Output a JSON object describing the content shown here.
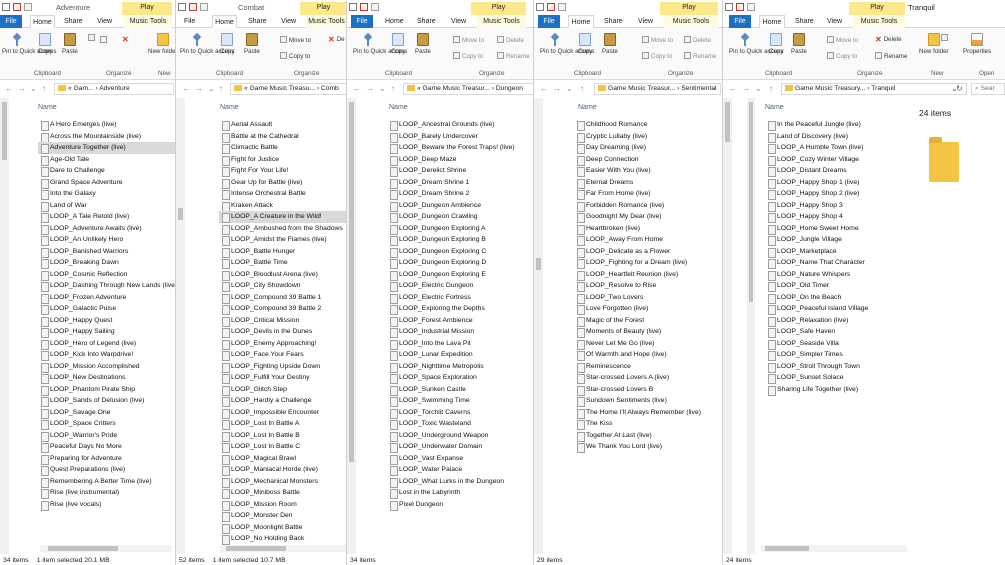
{
  "ribbon_tabs": {
    "file": "File",
    "home": "Home",
    "share": "Share",
    "view": "View",
    "music_tools": "Music Tools",
    "play": "Play"
  },
  "ribbon_labels": {
    "pin": "Pin to Quick access",
    "copy": "Copy",
    "paste": "Paste",
    "new_folder": "New folder",
    "properties": "Properties",
    "clipboard": "Clipboard",
    "organize": "Organize",
    "new": "New",
    "open": "Open",
    "move_to": "Move to",
    "copy_to": "Copy to",
    "delete": "Delete",
    "rename": "Rename",
    "delete_short": "De"
  },
  "column_name": "Name",
  "windows": [
    {
      "title": "Adventure",
      "path": "« Gam... › Adventure",
      "status_items": "34 items",
      "status_sel": "1 item selected  20.1 MB",
      "files": [
        "A Hero Emerges (live)",
        "Across the Mountainside (live)",
        "Adventure Together (live)",
        "Age-Old Tale",
        "Dare to Challenge",
        "Grand Space Adventure",
        "Into the Galaxy",
        "Land of War",
        "LOOP_A Tale Retold (live)",
        "LOOP_Adventure Awaits (live)",
        "LOOP_An Unlikely Hero",
        "LOOP_Banished Warriors",
        "LOOP_Breaking Dawn",
        "LOOP_Cosmic Reflection",
        "LOOP_Dashing Through New Lands (live)",
        "LOOP_Frozen Adventure",
        "LOOP_Galactic Pulse",
        "LOOP_Happy Quest",
        "LOOP_Happy Sailing",
        "LOOP_Hero of Legend (live)",
        "LOOP_Kick Into Warpdrive!",
        "LOOP_Mission Accomplished",
        "LOOP_New Destinations",
        "LOOP_Phantom Pirate Ship",
        "LOOP_Sands of Delusion (live)",
        "LOOP_Savage One",
        "LOOP_Space Critters",
        "LOOP_Warrior's Pride",
        "Peaceful Days No More",
        "Preparing for Adventure",
        "Quest Preparations (live)",
        "Remembering A Better Time (live)",
        "Rise (live instrumental)",
        "Rise (live vocals)"
      ],
      "selected": 2
    },
    {
      "title": "Combat",
      "path": "« Game Music Treasu... › Comb",
      "status_items": "52 items",
      "status_sel": "1 item selected  10.7 MB",
      "files": [
        "Aerial Assault",
        "Battle at the Cathedral",
        "Climactic Battle",
        "Fight for Justice",
        "Fight For Your Life!",
        "Gear Up for Battle (live)",
        "Intense Orchestral Battle",
        "Kraken Attack",
        "LOOP_A Creature in the Wild!",
        "LOOP_Ambushed from the Shadows",
        "LOOP_Amidst the Flames (live)",
        "LOOP_Battle Hunger",
        "LOOP_Battle Time",
        "LOOP_Bloodlust Arena (live)",
        "LOOP_City Showdown",
        "LOOP_Compound 39 Battle 1",
        "LOOP_Compound 39 Battle 2",
        "LOOP_Critical Mission",
        "LOOP_Devils in the Dunes",
        "LOOP_Enemy Approaching!",
        "LOOP_Face Your Fears",
        "LOOP_Fighting Upside Down",
        "LOOP_Fulfill Your Destiny",
        "LOOP_Glitch Step",
        "LOOP_Hardly a Challenge",
        "LOOP_Impossible Encounter",
        "LOOP_Lost In Battle A",
        "LOOP_Lost In Battle B",
        "LOOP_Lost In Battle C",
        "LOOP_Magical Brawl",
        "LOOP_Maniacal Horde (live)",
        "LOOP_Mechanical Monsters",
        "LOOP_Miniboss Battle",
        "LOOP_Mission Room",
        "LOOP_Monster Den",
        "LOOP_Moonlight Battle",
        "LOOP_No Holding Back"
      ],
      "selected": 8
    },
    {
      "title": "",
      "path": "« Game Music Treasur... › Dungeon",
      "status_items": "34 items",
      "status_sel": "",
      "files": [
        "LOOP_Ancestral Grounds (live)",
        "LOOP_Barely Undercover",
        "LOOP_Beware the Forest Traps! (live)",
        "LOOP_Deep Maze",
        "LOOP_Derelict Shrine",
        "LOOP_Dream Shrine 1",
        "LOOP_Dream Shrine 2",
        "LOOP_Dungeon Ambience",
        "LOOP_Dungeon Crawling",
        "LOOP_Dungeon Exploring A",
        "LOOP_Dungeon Exploring B",
        "LOOP_Dungeon Exploring C",
        "LOOP_Dungeon Exploring D",
        "LOOP_Dungeon Exploring E",
        "LOOP_Electric Dungeon",
        "LOOP_Electric Fortress",
        "LOOP_Exploring the Depths",
        "LOOP_Forest Ambience",
        "LOOP_Industrial Mission",
        "LOOP_Into the Lava Pit",
        "LOOP_Lunar Expedition",
        "LOOP_Nighttime Metropolis",
        "LOOP_Space Exploration",
        "LOOP_Sunken Castle",
        "LOOP_Swimming Time",
        "LOOP_Torchlit Caverns",
        "LOOP_Toxic Wasteland",
        "LOOP_Underground Weapon",
        "LOOP_Underwater Domain",
        "LOOP_Vast Expanse",
        "LOOP_Water Palace",
        "LOOP_What Lurks in the Dungeon",
        "Lost in the Labyrinth",
        "Pixel Dungeon"
      ],
      "selected": -1
    },
    {
      "title": "",
      "path": "Game Music Treasur... › Sentimental",
      "status_items": "29 items",
      "status_sel": "",
      "files": [
        "Childhood Romance",
        "Cryptic Lullaby (live)",
        "Day Dreaming (live)",
        "Deep Connection",
        "Easier With You (live)",
        "Eternal Dreams",
        "Far From Home (live)",
        "Forbidden Romance (live)",
        "Goodnight My Dear (live)",
        "Heartbroken (live)",
        "LOOP_Away From Home",
        "LOOP_Delicate as a Flower",
        "LOOP_Fighting for a Dream (live)",
        "LOOP_Heartfelt Reunion (live)",
        "LOOP_Resolve to Rise",
        "LOOP_Two Lovers",
        "Love Forgotten (live)",
        "Magic of the Forest",
        "Moments of Beauty (live)",
        "Never Let Me Go (live)",
        "Of Warmth and Hope (live)",
        "Reminescence",
        "Star-crossed Lovers A (live)",
        "Star-crossed Lovers B",
        "Sundown Sentiments (live)",
        "The Home I'll Always Remember (live)",
        "The Kiss",
        "Together At Last (live)",
        "We Thank You Lord (live)"
      ],
      "selected": -1
    },
    {
      "title": "Tranquil",
      "path": "Game Music Treasury... › Tranquil",
      "search": "Sear",
      "items_count": "24 items",
      "status_items": "24 items",
      "status_sel": "",
      "files": [
        "In the Peaceful Jungle (live)",
        "Land of Discovery (live)",
        "LOOP_A Humble Town (live)",
        "LOOP_Cozy Winter Village",
        "LOOP_Distant Dreams",
        "LOOP_Happy Shop 1 (live)",
        "LOOP_Happy Shop 2 (live)",
        "LOOP_Happy Shop 3",
        "LOOP_Happy Shop 4",
        "LOOP_Home Sweet Home",
        "LOOP_Jungle Village",
        "LOOP_Marketplace",
        "LOOP_Name That Character",
        "LOOP_Nature Whispers",
        "LOOP_Old Timer",
        "LOOP_On the Beach",
        "LOOP_Peaceful Island Village",
        "LOOP_Relaxation (live)",
        "LOOP_Safe Haven",
        "LOOP_Seaside Villa",
        "LOOP_Simpler Times",
        "LOOP_Stroll Through Town",
        "LOOP_Sunset Solace",
        "Sharing Life Together (live)"
      ],
      "selected": -1
    }
  ]
}
